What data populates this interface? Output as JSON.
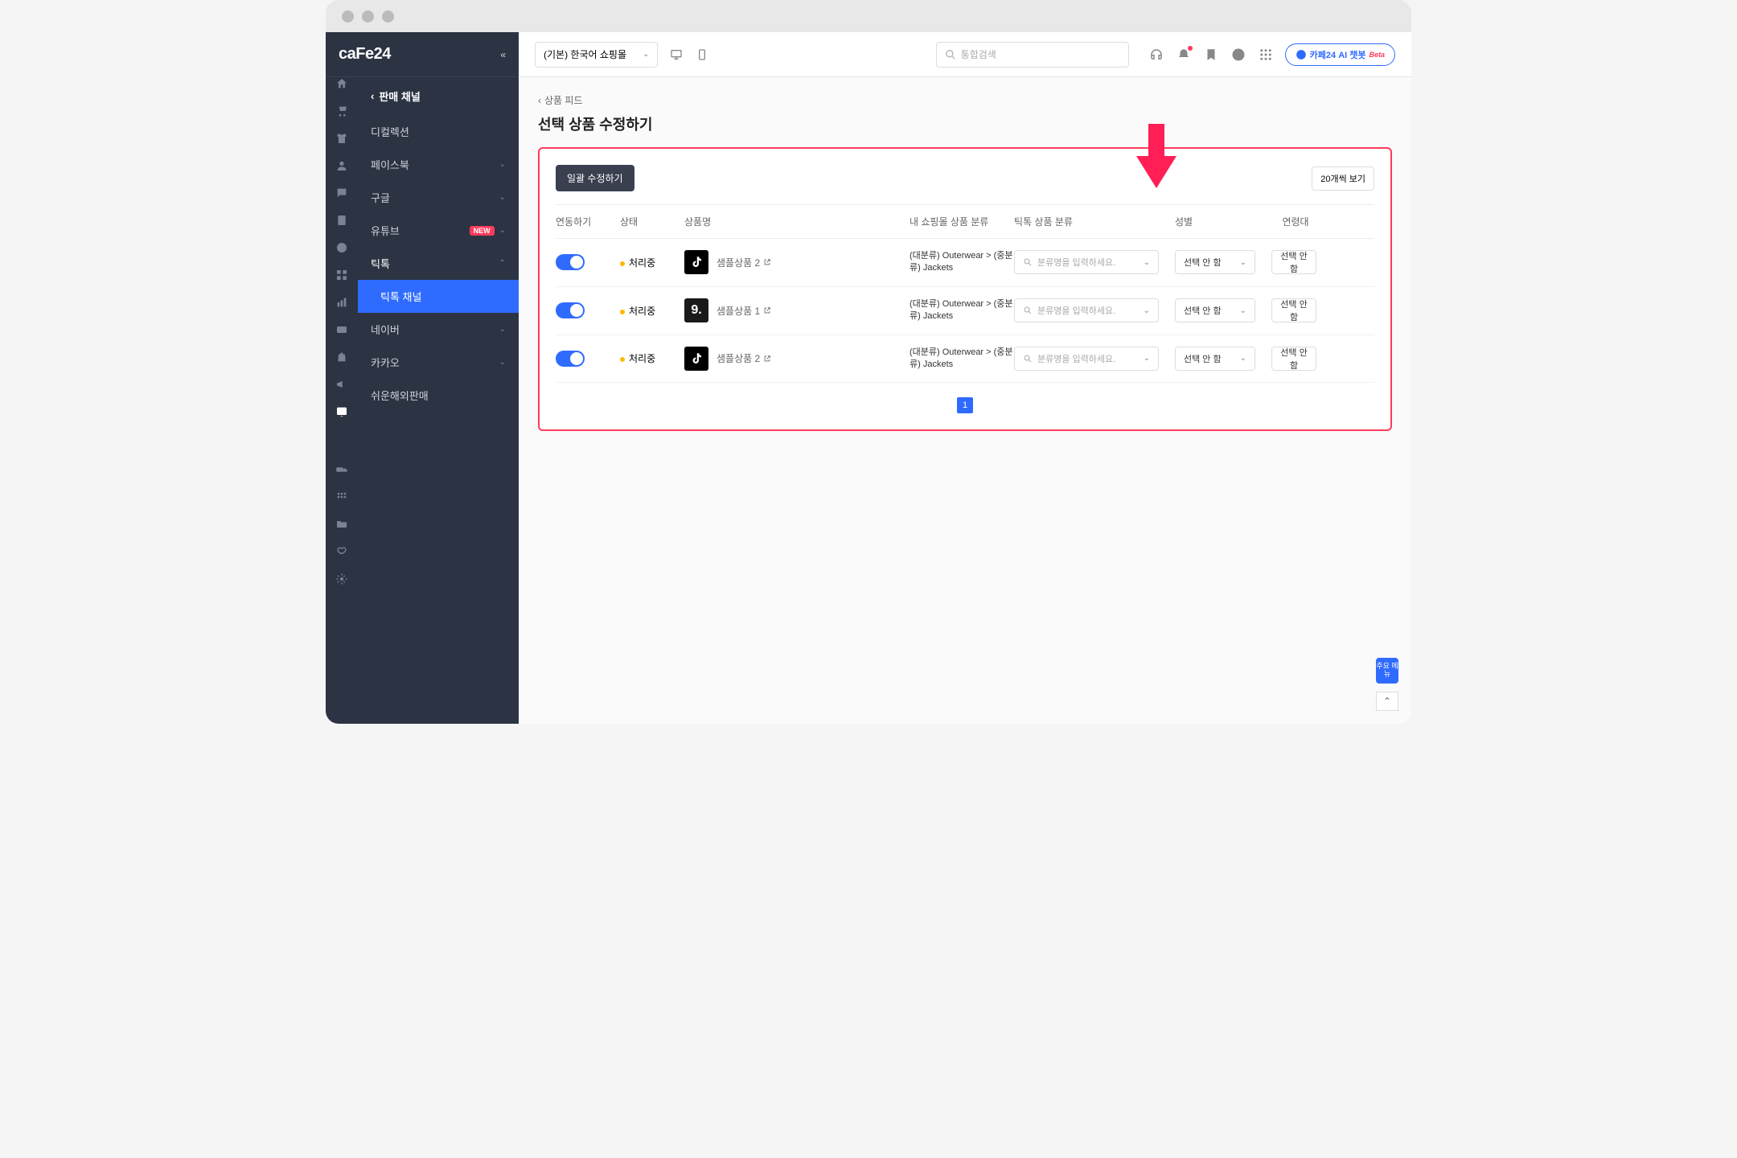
{
  "browser": {
    "logo": "caFe24"
  },
  "topbar": {
    "shop_selector": "(기본) 한국어 쇼핑몰",
    "search_placeholder": "통합검색",
    "chatbot_label": "카페24 AI 챗봇",
    "chatbot_badge": "Beta"
  },
  "sidebar": {
    "back_label": "판매 채널",
    "items": [
      {
        "label": "디컬렉션",
        "chevron": false
      },
      {
        "label": "페이스북",
        "chevron": true
      },
      {
        "label": "구글",
        "chevron": true
      },
      {
        "label": "유튜브",
        "chevron": true,
        "new": true
      },
      {
        "label": "틱톡",
        "chevron": true,
        "open": true
      },
      {
        "label": "틱톡 채널",
        "sub": true,
        "selected": true
      },
      {
        "label": "네이버",
        "chevron": true
      },
      {
        "label": "카카오",
        "chevron": true
      },
      {
        "label": "쉬운해외판매",
        "chevron": false
      }
    ],
    "new_badge": "NEW"
  },
  "page": {
    "breadcrumb": "상품 피드",
    "title": "선택 상품 수정하기",
    "bulk_button": "일괄 수정하기",
    "page_size": "20개씩 보기"
  },
  "table": {
    "headers": {
      "sync": "연동하기",
      "status": "상태",
      "name": "상품명",
      "my_category": "내 쇼핑몰 상품 분류",
      "tt_category": "틱톡 상품 분류",
      "gender": "성별",
      "age": "연령대"
    },
    "status_label": "처리중",
    "category_text": "(대분류) Outerwear > (중분류) Jackets",
    "tt_placeholder": "분류명을 입력하세요.",
    "gender_default": "선택 안 함",
    "age_default": "선택 안 함",
    "rows": [
      {
        "name": "샘플상품 2",
        "thumb": "tiktok"
      },
      {
        "name": "샘플상품 1",
        "thumb": "nine"
      },
      {
        "name": "샘플상품 2",
        "thumb": "tiktok"
      }
    ]
  },
  "pagination": {
    "current": "1"
  },
  "quick_menu": "주요\n메뉴"
}
